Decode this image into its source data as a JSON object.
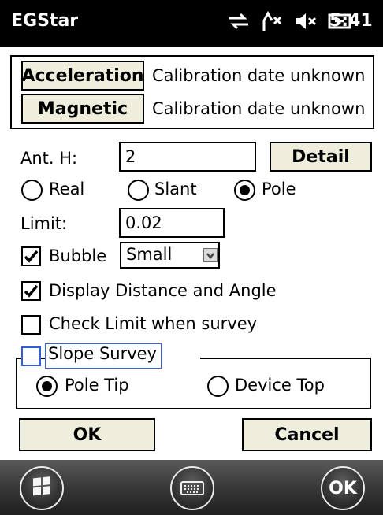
{
  "status_bar": {
    "app_title": "EGStar",
    "time": "5:41",
    "icons": [
      "sync-arrows-icon",
      "signal-off-icon",
      "speaker-muted-icon",
      "battery-charging-icon"
    ]
  },
  "calibration": {
    "acceleration_button": "Acceleration",
    "acceleration_status": "Calibration date unknown",
    "magnetic_button": "Magnetic",
    "magnetic_status": "Calibration date unknown"
  },
  "antenna": {
    "label": "Ant. H:",
    "value": "2",
    "detail_button": "Detail",
    "modes": [
      {
        "label": "Real",
        "selected": false
      },
      {
        "label": "Slant",
        "selected": false
      },
      {
        "label": "Pole",
        "selected": true
      }
    ]
  },
  "limit": {
    "label": "Limit:",
    "value": "0.02"
  },
  "bubble": {
    "label": "Bubble",
    "checked": true,
    "size_value": "Small"
  },
  "options": {
    "display_distance_label": "Display Distance and Angle",
    "display_distance_checked": true,
    "check_limit_label": "Check Limit when survey",
    "check_limit_checked": false
  },
  "slope_survey": {
    "label": "Slope Survey",
    "checked": false,
    "pole_tip_label": "Pole Tip",
    "pole_tip_selected": true,
    "device_top_label": "Device Top",
    "device_top_selected": false
  },
  "actions": {
    "ok_label": "OK",
    "cancel_label": "Cancel"
  },
  "taskbar": {
    "ok_round_label": "OK"
  }
}
